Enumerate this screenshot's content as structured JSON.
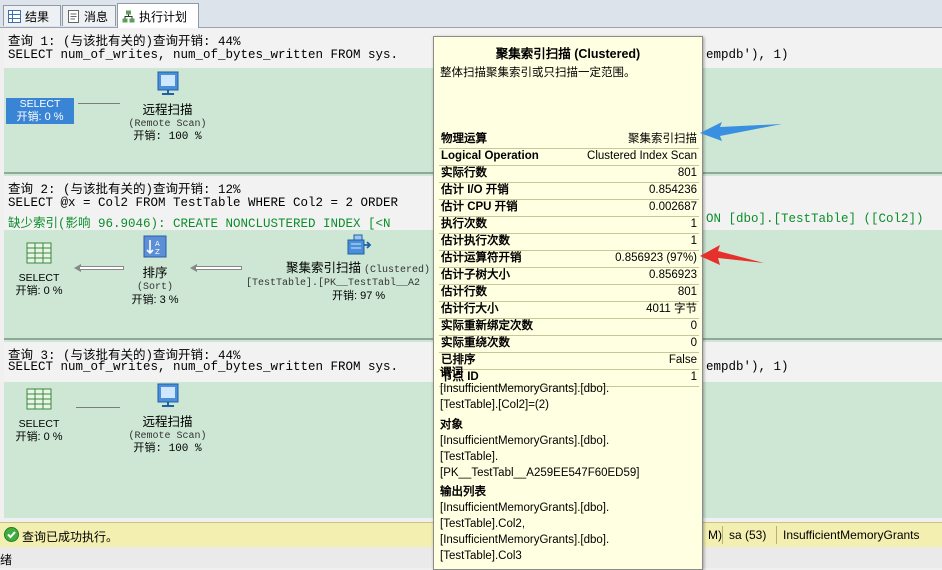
{
  "tabs": [
    {
      "label": "结果",
      "icon": "grid-icon"
    },
    {
      "label": "消息",
      "icon": "message-icon"
    },
    {
      "label": "执行计划",
      "icon": "execution-plan-icon",
      "active": true
    }
  ],
  "queries": [
    {
      "header": "查询 1: (与该批有关的)查询开销: 44%",
      "sql": "SELECT num_of_writes, num_of_bytes_written FROM sys.",
      "sql_tail": "empdb'), 1)",
      "select_op": {
        "label": "SELECT",
        "cost": "开销: 0 %"
      },
      "remote_op": {
        "name": "远程扫描",
        "en": "(Remote Scan)",
        "cost": "开销: 100 %"
      }
    },
    {
      "header": "查询 2: (与该批有关的)查询开销: 12%",
      "sql": "SELECT @x = Col2 FROM TestTable WHERE Col2 = 2 ORDER",
      "missing_index": "缺少索引(影响 96.9046): CREATE NONCLUSTERED INDEX [<N",
      "missing_index_tail": "ON [dbo].[TestTable] ([Col2])",
      "select_op": {
        "label": "SELECT",
        "cost": "开销: 0 %"
      },
      "sort_op": {
        "name": "排序",
        "en": "(Sort)",
        "cost": "开销: 3 %"
      },
      "scan_op": {
        "name": "聚集索引扫描",
        "en": "(Clustered)",
        "object": "[TestTable].[PK__TestTabl__A2",
        "cost": "开销: 97 %"
      }
    },
    {
      "header": "查询 3: (与该批有关的)查询开销: 44%",
      "sql": "SELECT num_of_writes, num_of_bytes_written FROM sys.",
      "sql_tail": "empdb'), 1)",
      "select_op": {
        "label": "SELECT",
        "cost": "开销: 0 %"
      },
      "remote_op": {
        "name": "远程扫描",
        "en": "(Remote Scan)",
        "cost": "开销: 100 %"
      }
    }
  ],
  "tooltip": {
    "title": "聚集索引扫描 (Clustered)",
    "subtitle": "整体扫描聚集索引或只扫描一定范围。",
    "props": [
      {
        "k": "物理运算",
        "v": "聚集索引扫描"
      },
      {
        "k": "Logical Operation",
        "v": "Clustered Index Scan"
      },
      {
        "k": "实际行数",
        "v": "801"
      },
      {
        "k": "估计 I/O 开销",
        "v": "0.854236"
      },
      {
        "k": "估计 CPU 开销",
        "v": "0.002687"
      },
      {
        "k": "执行次数",
        "v": "1"
      },
      {
        "k": "估计执行次数",
        "v": "1"
      },
      {
        "k": "估计运算符开销",
        "v": "0.856923 (97%)"
      },
      {
        "k": "估计子树大小",
        "v": "0.856923"
      },
      {
        "k": "估计行数",
        "v": "801"
      },
      {
        "k": "估计行大小",
        "v": "4011 字节"
      },
      {
        "k": "实际重新绑定次数",
        "v": "0"
      },
      {
        "k": "实际重绕次数",
        "v": "0"
      },
      {
        "k": "已排序",
        "v": "False"
      },
      {
        "k": "节点 ID",
        "v": "1"
      }
    ],
    "predicate_label": "谓词",
    "predicate": [
      "[InsufficientMemoryGrants].[dbo].",
      "[TestTable].[Col2]=(2)"
    ],
    "object_label": "对象",
    "object": [
      "[InsufficientMemoryGrants].[dbo].",
      "[TestTable].",
      "[PK__TestTabl__A259EE547F60ED59]"
    ],
    "output_label": "输出列表",
    "output": [
      "[InsufficientMemoryGrants].[dbo].",
      "[TestTable].Col2,",
      "[InsufficientMemoryGrants].[dbo].",
      "[TestTable].Col3"
    ]
  },
  "status": {
    "message": "查询已成功执行。",
    "partial": "M)",
    "user": "sa (53)",
    "database": "InsufficientMemoryGrants"
  },
  "bottom_partial": "绪",
  "colors": {
    "blue_annotation": "#3b8fe0",
    "red_annotation": "#e5302c",
    "plan_bg": "#cde7d4"
  }
}
